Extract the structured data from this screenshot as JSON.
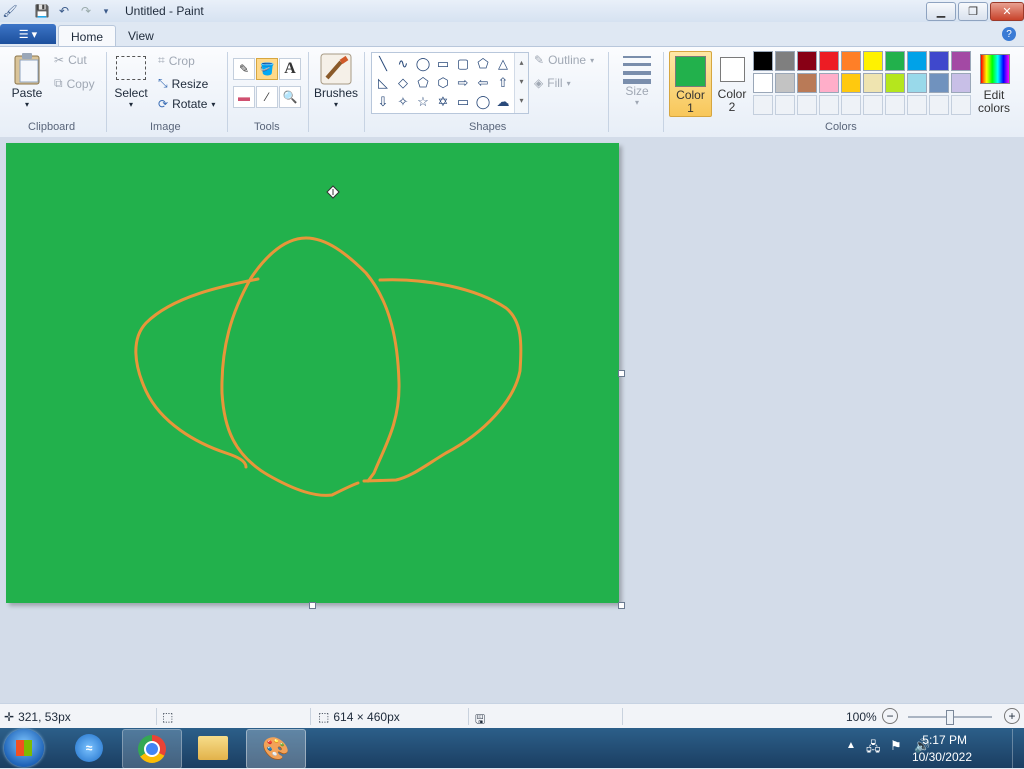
{
  "window": {
    "title": "Untitled - Paint"
  },
  "ribbon_tabs": {
    "home": "Home",
    "view": "View"
  },
  "clipboard": {
    "paste": "Paste",
    "cut": "Cut",
    "copy": "Copy",
    "group_label": "Clipboard"
  },
  "image": {
    "select": "Select",
    "crop": "Crop",
    "resize": "Resize",
    "rotate": "Rotate",
    "group_label": "Image"
  },
  "tools": {
    "group_label": "Tools"
  },
  "brushes": {
    "label": "Brushes"
  },
  "shapes": {
    "outline": "Outline",
    "fill": "Fill",
    "group_label": "Shapes"
  },
  "size": {
    "label": "Size"
  },
  "colors": {
    "color1_line1": "Color",
    "color1_line2": "1",
    "color2_line1": "Color",
    "color2_line2": "2",
    "edit_line1": "Edit",
    "edit_line2": "colors",
    "group_label": "Colors",
    "color1": "#22b14c",
    "color2": "#ffffff",
    "row1": [
      "#000000",
      "#7f7f7f",
      "#880015",
      "#ed1c24",
      "#ff7f27",
      "#fff200",
      "#22b14c",
      "#00a2e8",
      "#3f48cc",
      "#a349a4"
    ],
    "row2": [
      "#ffffff",
      "#c3c3c3",
      "#b97a57",
      "#ffaec9",
      "#ffc90e",
      "#efe4b0",
      "#b5e61d",
      "#99d9ea",
      "#7092be",
      "#c8bfe7"
    ]
  },
  "canvas": {
    "background": "#22b14c",
    "stroke": "#e8963a"
  },
  "status": {
    "cursor_pos": "321, 53px",
    "canvas_size": "614 × 460px",
    "zoom": "100%"
  },
  "taskbar": {
    "time": "5:17 PM",
    "date": "10/30/2022"
  }
}
